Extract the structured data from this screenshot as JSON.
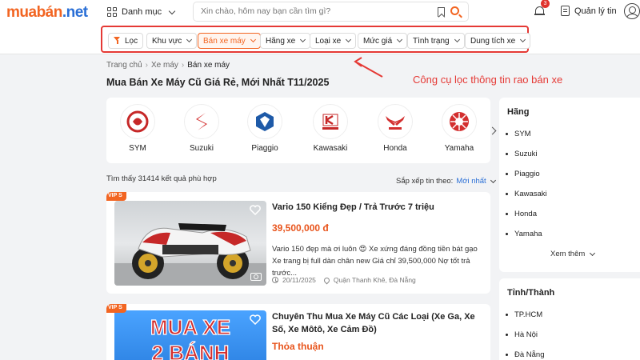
{
  "header": {
    "logo_part1": "muabán",
    "logo_part2": ".net",
    "category_label": "Danh mục",
    "search_placeholder": "Xin chào, hôm nay bạn cần tìm gì?",
    "notification_count": "3",
    "manage_label": "Quản lý tin"
  },
  "filters": {
    "filter_label": "Lọc",
    "chips": [
      "Khu vực",
      "Bán xe máy",
      "Hãng xe",
      "Loại xe",
      "Mức giá",
      "Tình trạng",
      "Dung tích xe"
    ],
    "active": "Bán xe máy"
  },
  "breadcrumb": [
    "Trang chủ",
    "Xe máy",
    "Bán xe máy"
  ],
  "page_title": "Mua Bán Xe Máy Cũ Giá Rẻ, Mới Nhất T11/2025",
  "annotation": "Công cụ lọc thông tin rao bán xe",
  "brands": [
    "SYM",
    "Suzuki",
    "Piaggio",
    "Kawasaki",
    "Honda",
    "Yamaha"
  ],
  "results_text": "Tìm thấy 31414 kết quả phù hợp",
  "sort": {
    "label": "Sắp xếp tin theo:",
    "value": "Mới nhất"
  },
  "listings": [
    {
      "badge": "VIP S",
      "title": "Vario 150 Kiểng Đẹp / Trả Trước 7 triệu",
      "price": "39,500,000 đ",
      "description": "Vario 150 đẹp mà ơi luôn 😍 Xe xứng đáng đồng tiền bát gạo Xe trang bị full dàn chân new Giá chỉ 39,500,000 Nợ tốt trả trước...",
      "date": "20/11/2025",
      "location": "Quận Thanh Khê, Đà Nẵng"
    },
    {
      "badge": "VIP S",
      "title": "Chuyên Thu Mua Xe Máy Cũ Các Loại (Xe Ga, Xe Số, Xe Môtô, Xe Cảm Đồ)",
      "price": "Thỏa thuận",
      "image_text_line1": "MUA XE",
      "image_text_line2": "2 BÁNH"
    }
  ],
  "sidebar": {
    "brand_title": "Hãng",
    "brand_items": [
      "SYM",
      "Suzuki",
      "Piaggio",
      "Kawasaki",
      "Honda",
      "Yamaha"
    ],
    "more_label": "Xem thêm",
    "province_title": "Tỉnh/Thành",
    "province_items": [
      "TP.HCM",
      "Hà Nội",
      "Đà Nẵng"
    ]
  },
  "colors": {
    "brand_orange": "#f26522",
    "brand_blue": "#2a6fd6",
    "annotation_red": "#e53935",
    "price": "#e8541c"
  }
}
